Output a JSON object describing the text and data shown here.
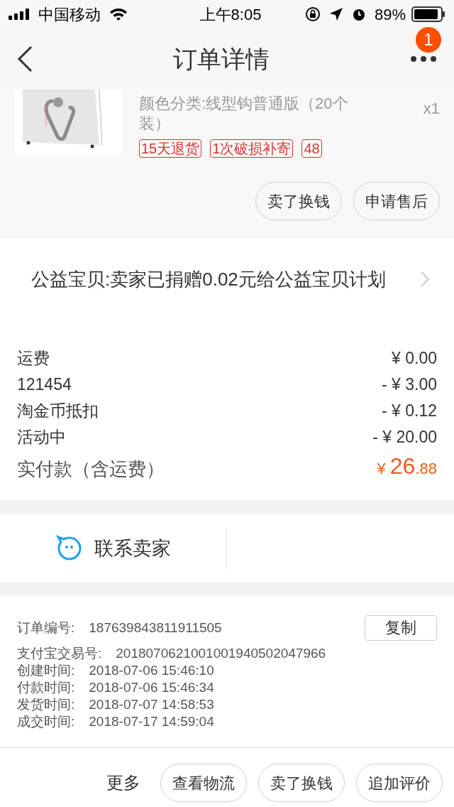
{
  "status_bar": {
    "carrier": "中国移动",
    "time": "上午8:05",
    "battery": "89%"
  },
  "nav": {
    "title": "订单详情",
    "badge": "1"
  },
  "product": {
    "sku": "颜色分类:线型钩普通版（20个装）",
    "quantity": "x1",
    "tags": [
      "15天退货",
      "1次破损补寄",
      "48"
    ],
    "buttons": [
      "卖了换钱",
      "申请售后"
    ]
  },
  "charity": {
    "text": "公益宝贝:卖家已捐赠0.02元给公益宝贝计划"
  },
  "fees": [
    {
      "label": "运费",
      "value": "¥ 0.00"
    },
    {
      "label": "121454",
      "value": "- ¥ 3.00"
    },
    {
      "label": "淘金币抵扣",
      "value": "- ¥ 0.12"
    },
    {
      "label": "活动中",
      "value": "- ¥ 20.00"
    }
  ],
  "total": {
    "label": "实付款（含运费）",
    "currency": "¥",
    "integer": "26",
    "decimal": ".88"
  },
  "contact": {
    "label": "联系卖家"
  },
  "order_info": {
    "rows": [
      {
        "label": "订单编号:",
        "value": "187639843811911505"
      },
      {
        "label": "支付宝交易号:",
        "value": "2018070621001001940502047966"
      },
      {
        "label": "创建时间:",
        "value": "2018-07-06 15:46:10"
      },
      {
        "label": "付款时间:",
        "value": "2018-07-06 15:46:34"
      },
      {
        "label": "发货时间:",
        "value": "2018-07-07 14:58:53"
      },
      {
        "label": "成交时间:",
        "value": "2018-07-17 14:59:04"
      }
    ],
    "copy_button": "复制"
  },
  "footer": {
    "more": "更多",
    "buttons": [
      "查看物流",
      "卖了换钱",
      "追加评价"
    ]
  }
}
